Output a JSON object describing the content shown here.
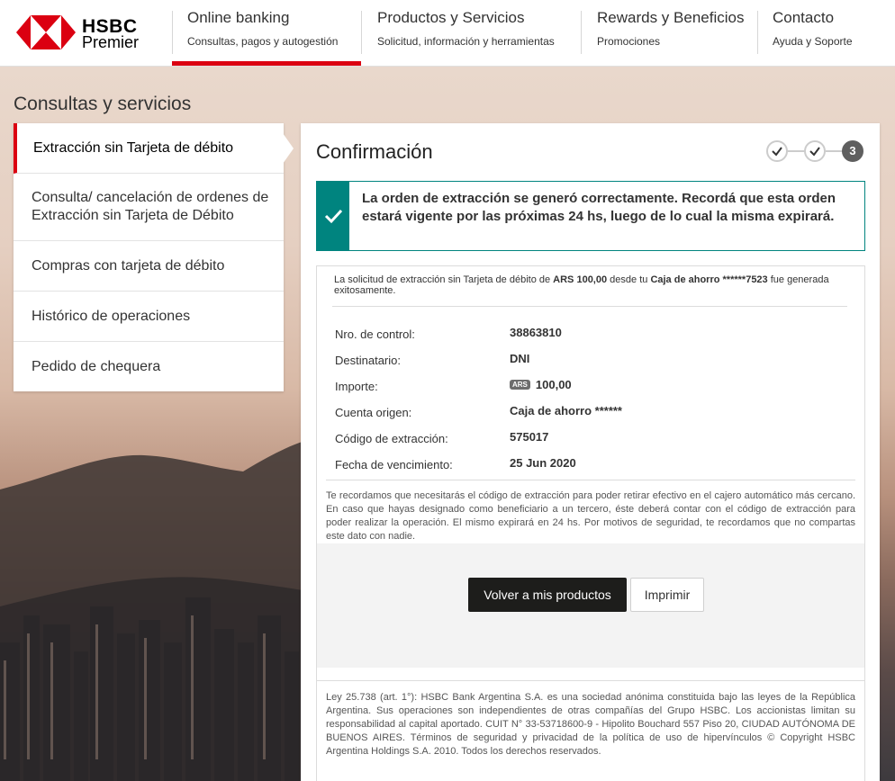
{
  "brand": {
    "name": "HSBC",
    "tier": "Premier"
  },
  "nav": [
    {
      "title": "Online banking",
      "sub": "Consultas, pagos y autogestión"
    },
    {
      "title": "Productos y Servicios",
      "sub": "Solicitud, información y herramientas"
    },
    {
      "title": "Rewards y Beneficios",
      "sub": "Promociones"
    },
    {
      "title": "Contacto",
      "sub": "Ayuda y Soporte"
    }
  ],
  "page_title": "Consultas y servicios",
  "side_menu": [
    "Extracción sin Tarjeta de débito",
    "Consulta/ cancelación de ordenes de Extracción sin Tarjeta de Débito",
    "Compras con tarjeta de débito",
    "Histórico de operaciones",
    "Pedido de chequera"
  ],
  "panel": {
    "title": "Confirmación",
    "step_current": "3",
    "success_message": "La orden de extracción se generó correctamente. Recordá que esta orden estará vigente por las próximas 24 hs, luego de lo cual la misma expirará.",
    "intro": {
      "pre": "La solicitud de extracción sin Tarjeta de débito de ",
      "amount": "ARS 100,00",
      "mid": " desde tu ",
      "account": "Caja de ahorro ******7523",
      "post": " fue generada exitosamente."
    },
    "rows": [
      {
        "label": "Nro. de control:",
        "value": "38863810"
      },
      {
        "label": "Destinatario:",
        "value": "DNI"
      },
      {
        "label": "Importe:",
        "currency": "ARS",
        "value": "100,00"
      },
      {
        "label": "Cuenta origen:",
        "value": "Caja de ahorro ******"
      },
      {
        "label": "Código de extracción:",
        "value": "575017"
      },
      {
        "label": "Fecha de vencimiento:",
        "value": "25 Jun 2020"
      }
    ],
    "notice": "Te recordamos que necesitarás el código de extracción para poder retirar efectivo en el cajero automático más cercano. En caso que hayas designado como beneficiario a un tercero, éste deberá contar con el código de extracción para poder realizar la operación. El mismo expirará en 24 hs. Por motivos de seguridad, te recordamos que no compartas este dato con nadie.",
    "btn_back": "Volver a mis productos",
    "btn_print": "Imprimir",
    "legal": "Ley 25.738 (art. 1°): HSBC Bank Argentina S.A. es una sociedad anónima constituida bajo las leyes de la República Argentina. Sus operaciones son independientes de otras compañías del Grupo HSBC. Los accionistas limitan su responsabilidad al capital aportado. CUIT N° 33-53718600-9 - Hipolito Bouchard 557 Piso 20, CIUDAD AUTÓNOMA DE BUENOS AIRES. Términos de seguridad y privacidad de la política de uso de hipervínculos © Copyright HSBC Argentina Holdings S.A. 2010. Todos los derechos reservados."
  },
  "colors": {
    "brand_red": "#db0011",
    "success_teal": "#00847f",
    "primary_button": "#1d1d1b"
  }
}
